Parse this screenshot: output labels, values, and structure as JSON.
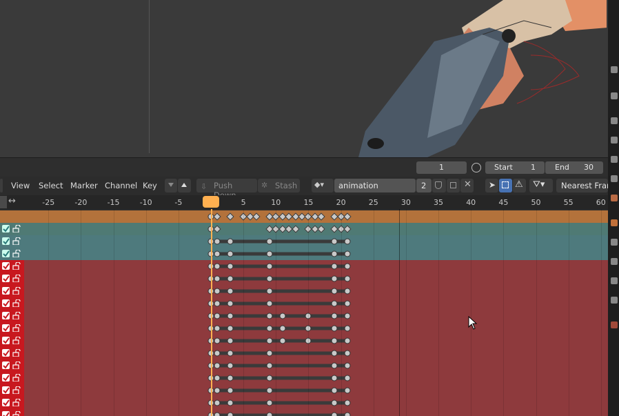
{
  "viewport": {
    "description_icon": "3d-viewport"
  },
  "timeline": {
    "current_frame": "1",
    "start_label": "Start",
    "start_value": "1",
    "end_label": "End",
    "end_value": "30"
  },
  "header": {
    "menus": [
      "View",
      "Select",
      "Marker",
      "Channel",
      "Key"
    ],
    "push_down": "Push Down",
    "stash": "Stash",
    "action_name": "animation",
    "action_users": "2",
    "snapping": "Nearest Frame"
  },
  "ruler": {
    "ticks": [
      "-25",
      "-20",
      "-15",
      "-10",
      "-5",
      "0",
      "5",
      "10",
      "15",
      "20",
      "25",
      "30",
      "35",
      "40",
      "45",
      "50",
      "55",
      "60"
    ],
    "current_frame": "0"
  },
  "colors": {
    "summary": "#b3723b",
    "object": "#4f7a74",
    "group_teal": "#4e7a7d",
    "group_red": "#8e3a3d",
    "accent_playhead": "#ffb050",
    "checkbox_red": "#c8181f",
    "checkbox_teal": "#3a9a9a"
  },
  "channels": [
    {
      "type": "summary",
      "frames": [
        0,
        1,
        3,
        5,
        6,
        7,
        9,
        10,
        11,
        12,
        13,
        14,
        15,
        16,
        17,
        19,
        20,
        21
      ]
    },
    {
      "type": "object",
      "frames": [
        0,
        1,
        9,
        10,
        11,
        12,
        13,
        15,
        16,
        17,
        19,
        20,
        21
      ]
    },
    {
      "type": "teal",
      "frames": [
        0,
        1,
        3,
        9,
        19,
        21
      ]
    },
    {
      "type": "teal",
      "frames": [
        0,
        1,
        3,
        9,
        19,
        21
      ]
    },
    {
      "type": "red",
      "frames": [
        0,
        1,
        3,
        9,
        19,
        21
      ]
    },
    {
      "type": "red",
      "frames": [
        0,
        1,
        3,
        9,
        19,
        21
      ]
    },
    {
      "type": "red",
      "frames": [
        0,
        1,
        3,
        9,
        19,
        21
      ]
    },
    {
      "type": "red",
      "frames": [
        0,
        1,
        3,
        9,
        19,
        21
      ]
    },
    {
      "type": "red",
      "frames": [
        0,
        1,
        3,
        9,
        11,
        15,
        19,
        21
      ]
    },
    {
      "type": "red",
      "frames": [
        0,
        1,
        3,
        9,
        11,
        15,
        19,
        21
      ]
    },
    {
      "type": "red",
      "frames": [
        0,
        1,
        3,
        9,
        11,
        15,
        19,
        21
      ]
    },
    {
      "type": "red",
      "frames": [
        0,
        1,
        3,
        9,
        19,
        21
      ]
    },
    {
      "type": "red",
      "frames": [
        0,
        1,
        3,
        9,
        19,
        21
      ]
    },
    {
      "type": "red",
      "frames": [
        0,
        1,
        3,
        9,
        19,
        21
      ]
    },
    {
      "type": "red",
      "frames": [
        0,
        1,
        3,
        9,
        19,
        21
      ]
    },
    {
      "type": "red",
      "frames": [
        0,
        1,
        3,
        9,
        19,
        21
      ]
    },
    {
      "type": "red",
      "frames": [
        0,
        1,
        3,
        9,
        19,
        21
      ]
    }
  ]
}
